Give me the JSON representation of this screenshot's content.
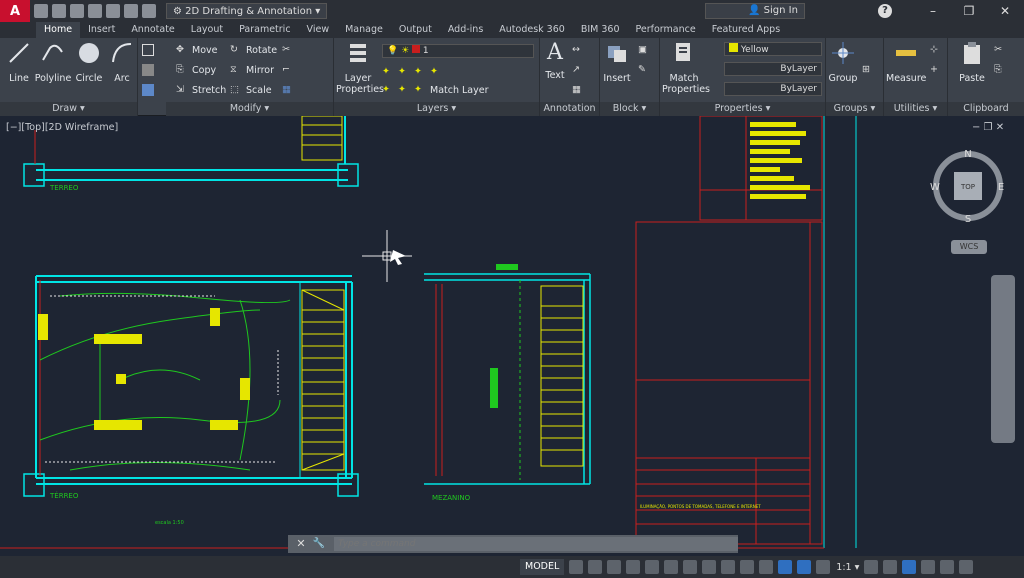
{
  "titlebar": {
    "logo": "A",
    "workspace": "2D Drafting & Annotation",
    "signin": "Sign In",
    "help": "?",
    "win_min": "–",
    "win_max": "❐",
    "win_close": "✕"
  },
  "tabs": [
    "Home",
    "Insert",
    "Annotate",
    "Layout",
    "Parametric",
    "View",
    "Manage",
    "Output",
    "Add-ins",
    "Autodesk 360",
    "BIM 360",
    "Performance",
    "Featured Apps"
  ],
  "ribbon": {
    "draw": {
      "title": "Draw ▾",
      "line": "Line",
      "polyline": "Polyline",
      "circle": "Circle",
      "arc": "Arc"
    },
    "modify": {
      "title": "Modify ▾",
      "move": "Move",
      "rotate": "Rotate",
      "copy": "Copy",
      "mirror": "Mirror",
      "stretch": "Stretch",
      "scale": "Scale"
    },
    "layers": {
      "title": "Layers ▾",
      "layer_properties": "Layer Properties",
      "layer_value": "1",
      "match_layer": "Match Layer"
    },
    "annotation": {
      "title": "Annotation ▾",
      "text": "Text"
    },
    "block": {
      "title": "Block ▾",
      "insert": "Insert"
    },
    "properties": {
      "title": "Properties ▾",
      "match_properties": "Match Properties",
      "color": "Yellow",
      "linetype": "ByLayer",
      "lineweight": "ByLayer"
    },
    "groups": {
      "title": "Groups ▾",
      "group": "Group"
    },
    "utilities": {
      "title": "Utilities ▾",
      "measure": "Measure"
    },
    "clipboard": {
      "title": "Clipboard",
      "paste": "Paste"
    }
  },
  "viewport": {
    "label": "[−][Top][2D Wireframe]",
    "controls": "−  ❐  ✕",
    "compass_n": "N",
    "compass_s": "S",
    "compass_e": "E",
    "compass_w": "W",
    "cube_top": "TOP",
    "wcs": "WCS"
  },
  "drawing": {
    "label_terreo_top": "TERREO",
    "label_terreo": "TÉRREO",
    "label_mezanino": "MEZANINO",
    "label_scale": "escala 1:50",
    "title_block_title": "ILUMINAÇÃO, PONTOS DE TOMADAS, TELEFONE E INTERNET"
  },
  "cmdline": {
    "close": "✕",
    "settings": "🔧",
    "placeholder": "Type a command"
  },
  "statusbar": {
    "model": "MODEL",
    "scale": "1:1 ▾"
  },
  "colors": {
    "cyan": "#00e5e5",
    "yellow": "#e6e600",
    "green": "#1fc81f",
    "red": "#c81e1e",
    "white": "#e8e8e8",
    "accent": "#2f6fc0"
  }
}
